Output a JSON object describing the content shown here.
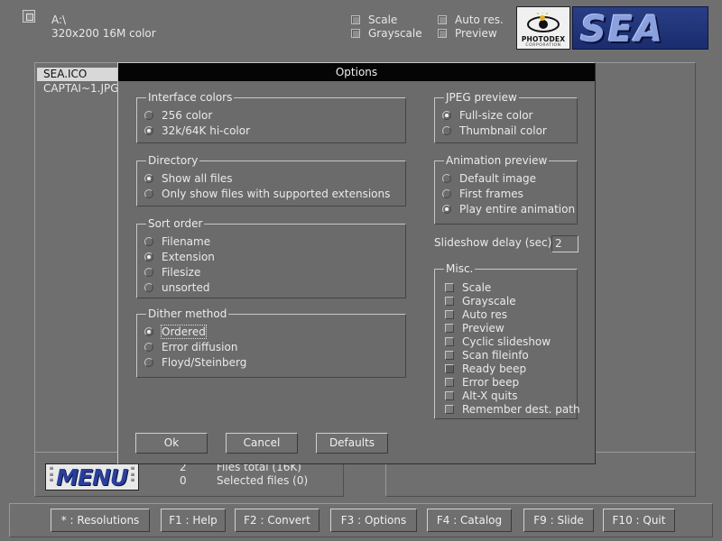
{
  "top": {
    "path": "A:\\",
    "image_info": "320x200  16M color",
    "checks": {
      "scale": "Scale",
      "grayscale": "Grayscale",
      "auto_res": "Auto res.",
      "preview": "Preview"
    },
    "logo_photodex": "PHOTODEX",
    "logo_photodex_sub": "CORPORATION",
    "logo_sea": "SEA"
  },
  "files": {
    "items": [
      "SEA.ICO",
      "CAPTAI~1.JPG"
    ],
    "total_count": "2",
    "total_label": "Files total (16K)",
    "selected_count": "0",
    "selected_label": "Selected files (0)"
  },
  "menu_logo": "MENU",
  "dialog": {
    "title": "Options",
    "interface_colors": {
      "label": "Interface colors",
      "options": [
        "256 color",
        "32k/64K hi-color"
      ],
      "selected": 1
    },
    "directory": {
      "label": "Directory",
      "options": [
        "Show all files",
        "Only show files with supported extensions"
      ],
      "selected": 0
    },
    "sort_order": {
      "label": "Sort order",
      "options": [
        "Filename",
        "Extension",
        "Filesize",
        "unsorted"
      ],
      "selected": 1
    },
    "dither": {
      "label": "Dither method",
      "options": [
        "Ordered",
        "Error diffusion",
        "Floyd/Steinberg"
      ],
      "selected": 0
    },
    "jpeg_preview": {
      "label": "JPEG preview",
      "options": [
        "Full-size color",
        "Thumbnail color"
      ],
      "selected": 0
    },
    "animation_preview": {
      "label": "Animation preview",
      "options": [
        "Default image",
        "First frames",
        "Play entire animation"
      ],
      "selected": 2
    },
    "slideshow": {
      "label": "Slideshow delay (sec)",
      "value": "2"
    },
    "misc": {
      "label": "Misc.",
      "items": [
        "Scale",
        "Grayscale",
        "Auto res",
        "Preview",
        "Cyclic slideshow",
        "Scan fileinfo",
        "Ready beep",
        "Error beep",
        "Alt-X quits",
        "Remember dest. path"
      ]
    },
    "buttons": {
      "ok": "Ok",
      "cancel": "Cancel",
      "defaults": "Defaults"
    }
  },
  "function_keys": [
    "* : Resolutions",
    "F1 : Help",
    "F2 : Convert",
    "F3 : Options",
    "F4 : Catalog",
    "F9 : Slide",
    "F10 : Quit"
  ]
}
